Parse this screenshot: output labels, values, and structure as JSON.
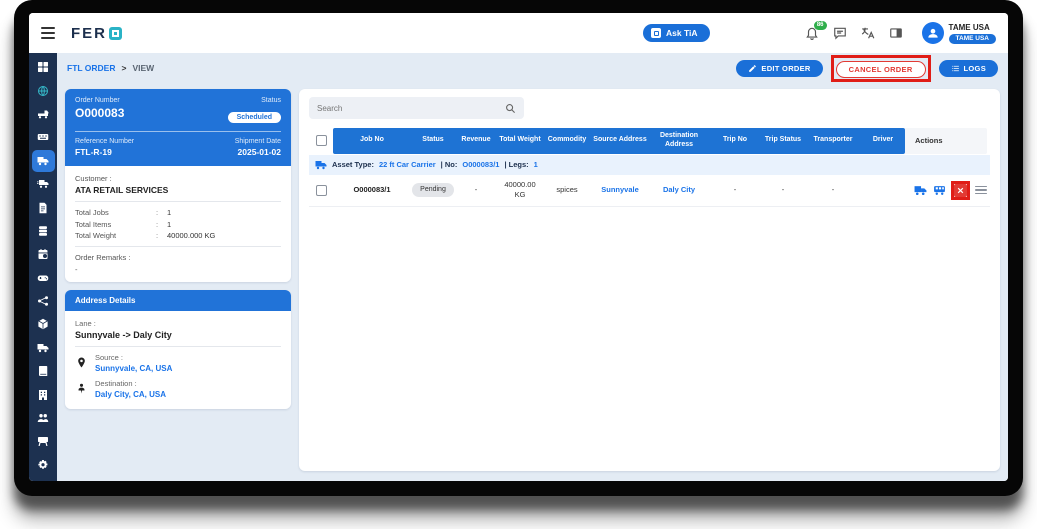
{
  "colors": {
    "primary_blue": "#1e73d4",
    "sidebar_navy": "#1d3150",
    "link_blue": "#1a73e8",
    "logo_teal": "#2ab3c6",
    "danger_red": "#e23a34",
    "highlight_red": "#e01d17",
    "badge_green": "#2fae4b"
  },
  "header": {
    "logo_text": "FER",
    "ask_tia_label": "Ask TiA",
    "notification_badge": "86",
    "icons": [
      "bell-icon",
      "chat-icon",
      "translate-icon",
      "panel-icon"
    ],
    "user": {
      "name": "TAME USA",
      "badge": "TAME USA"
    }
  },
  "sidebar": {
    "items": [
      {
        "name": "dashboard",
        "icon": "grid"
      },
      {
        "name": "global-network",
        "icon": "globe",
        "accent": true
      },
      {
        "name": "vehicle",
        "icon": "truck-flat"
      },
      {
        "name": "control-panel",
        "icon": "panel"
      },
      {
        "name": "ftl-order",
        "icon": "truck",
        "active": true
      },
      {
        "name": "fleet",
        "icon": "truck-fast"
      },
      {
        "name": "documents",
        "icon": "document"
      },
      {
        "name": "data-store",
        "icon": "database"
      },
      {
        "name": "planner",
        "icon": "calendar"
      },
      {
        "name": "tracking",
        "icon": "gamepad"
      },
      {
        "name": "integrations",
        "icon": "nodes"
      },
      {
        "name": "3d-view",
        "icon": "cube"
      },
      {
        "name": "transport",
        "icon": "truck"
      },
      {
        "name": "ledger",
        "icon": "book"
      },
      {
        "name": "company",
        "icon": "building"
      },
      {
        "name": "teams",
        "icon": "people"
      },
      {
        "name": "operations",
        "icon": "desk"
      },
      {
        "name": "settings",
        "icon": "gear"
      }
    ]
  },
  "breadcrumb": {
    "section": "FTL ORDER",
    "separator": ">",
    "page": "VIEW"
  },
  "toolbar": {
    "edit": "EDIT ORDER",
    "cancel": "CANCEL ORDER",
    "logs": "LOGS"
  },
  "order_card": {
    "order_number_label": "Order Number",
    "order_number": "O000083",
    "status_label": "Status",
    "status": "Scheduled",
    "reference_label": "Reference Number",
    "reference": "FTL-R-19",
    "shipment_date_label": "Shipment Date",
    "shipment_date": "2025-01-02",
    "customer_label": "Customer :",
    "customer": "ATA RETAIL SERVICES",
    "sep": ":",
    "stats": [
      {
        "label": "Total Jobs",
        "value": "1"
      },
      {
        "label": "Total Items",
        "value": "1"
      },
      {
        "label": "Total Weight",
        "value": "40000.000 KG"
      }
    ],
    "remarks_label": "Order Remarks :",
    "remarks": "-"
  },
  "address_card": {
    "title": "Address Details",
    "lane_label": "Lane :",
    "lane": "Sunnyvale -> Daly City",
    "source_label": "Source :",
    "source": "Sunnyvale, CA, USA",
    "destination_label": "Destination :",
    "destination": "Daly City, CA, USA"
  },
  "jobs_table": {
    "search_placeholder": "Search",
    "columns": [
      "Job No",
      "Status",
      "Revenue",
      "Total Weight",
      "Commodity",
      "Source Address",
      "Destination Address",
      "Trip No",
      "Trip Status",
      "Transporter",
      "Driver"
    ],
    "actions_label": "Actions",
    "group_row": {
      "asset_type_label": "Asset Type:",
      "asset_type": "22 ft Car Carrier",
      "no_label": "| No:",
      "no": "O000083/1",
      "legs_label": "| Legs:",
      "legs": "1"
    },
    "row": {
      "job_no": "O000083/1",
      "status": "Pending",
      "revenue": "-",
      "total_weight": "40000.00 KG",
      "commodity": "spices",
      "source": "Sunnyvale",
      "destination": "Daly City",
      "trip_no": "-",
      "trip_status": "-",
      "transporter": "-",
      "driver": ""
    }
  }
}
